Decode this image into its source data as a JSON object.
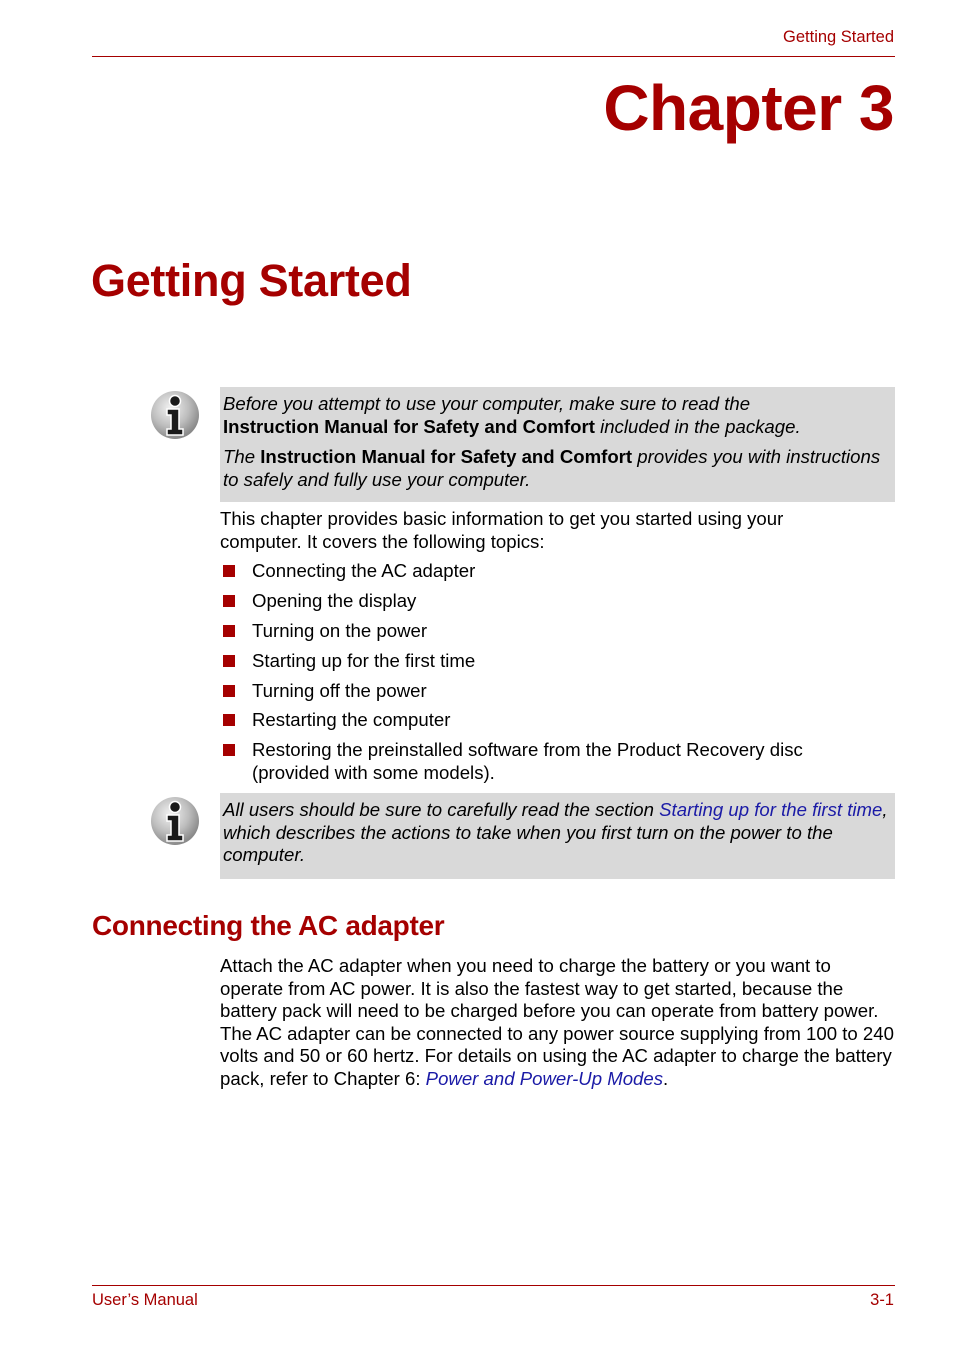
{
  "header": {
    "running_title": "Getting Started"
  },
  "chapter_label": "Chapter 3",
  "page_title": "Getting Started",
  "note1": {
    "icon": "info-icon",
    "p1_italic_start": "Before you attempt to use your computer, make sure to read the",
    "p1_bold": "Instruction Manual for Safety and Comfort",
    "p1_italic_end": " included in the package.",
    "p2_italic_start": "The ",
    "p2_bold": "Instruction Manual for Safety and Comfort",
    "p2_italic_end": " provides you with instructions to safely and fully use your computer."
  },
  "intro": "This chapter provides basic information to get you started using your computer. It covers the following topics:",
  "topics": [
    "Connecting the AC adapter",
    "Opening the display",
    "Turning on the power",
    "Starting up for the first time",
    "Turning off the power",
    "Restarting the computer",
    "Restoring the preinstalled software from the Product Recovery disc (provided with some models)."
  ],
  "note2": {
    "icon": "info-icon",
    "text_start": "All users should be sure to carefully read the section ",
    "link": "Starting up for the first time",
    "text_end": ", which describes the actions to take when you first turn on the power to the computer."
  },
  "section": {
    "heading": "Connecting the AC adapter",
    "body": "Attach the AC adapter when you need to charge the battery or you want to operate from AC power. It is also the fastest way to get started, because the battery pack will need to be charged before you can operate from battery power. The AC adapter can be connected to any power source supplying from 100 to 240 volts and 50 or 60 hertz. For details on using the AC adapter to charge the battery pack, refer to Chapter 6: ",
    "link": "Power and Power-Up Modes",
    "body_end": "."
  },
  "footer": {
    "left": "User’s Manual",
    "right": "3-1"
  },
  "colors": {
    "accent": "#a50000",
    "link": "#1a1aa6",
    "note_background": "#d9d9d9"
  }
}
